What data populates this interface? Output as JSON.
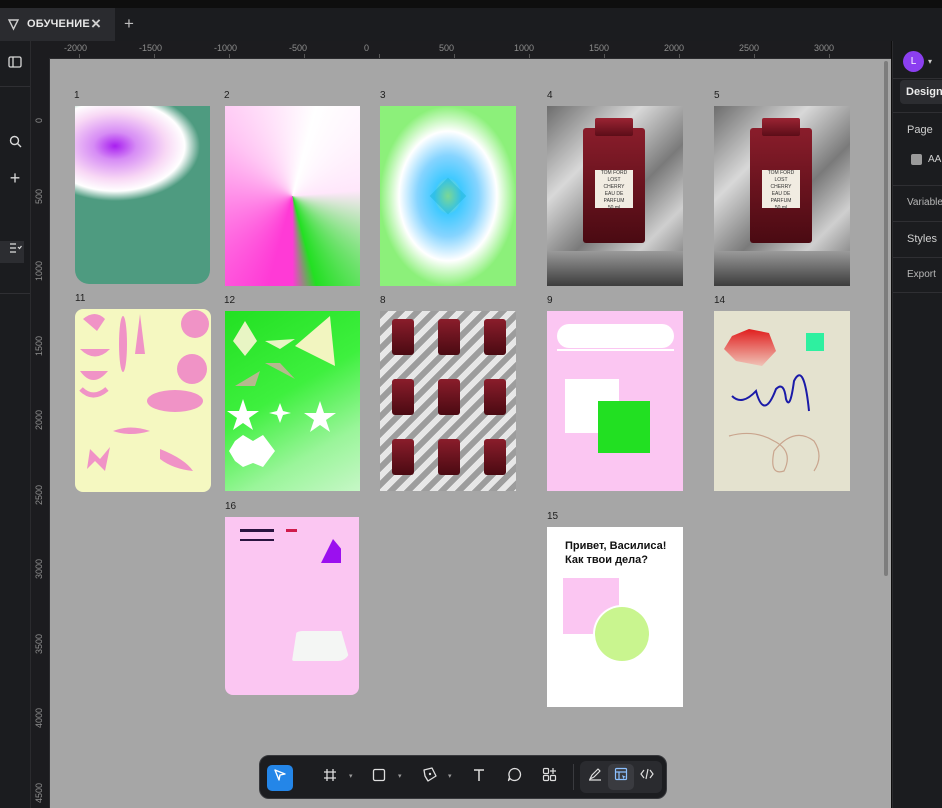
{
  "tab": {
    "title": "ОБУЧЕНИЕ",
    "close": "×",
    "new": "+"
  },
  "ruler_top": [
    "-2000",
    "-1500",
    "-1000",
    "-500",
    "0",
    "500",
    "1000",
    "1500",
    "2000",
    "2500",
    "3000"
  ],
  "ruler_left": [
    "0",
    "500",
    "1000",
    "1500",
    "2000",
    "2500",
    "3000",
    "3500",
    "4000",
    "4500"
  ],
  "frames": {
    "f1": "1",
    "f2": "2",
    "f3": "3",
    "f4": "4",
    "f5": "5",
    "f11": "11",
    "f12": "12",
    "f8": "8",
    "f9": "9",
    "f14": "14",
    "f16": "16",
    "f15": "15"
  },
  "perfume_label": {
    "brand": "TOM FORD",
    "line1": "LOST",
    "line2": "CHERRY",
    "line3": "EAU DE PARFUM",
    "line4": "50 ml"
  },
  "frame15": {
    "line1": "Привет, Василиса!",
    "line2": "Как твои дела?"
  },
  "right_panel": {
    "avatar": "L",
    "design": "Design",
    "page": "Page",
    "page_item": "AA",
    "variables": "Variable",
    "styles": "Styles",
    "export": "Export"
  },
  "colors": {
    "canvas": "#a6a6a6",
    "accent": "#2486e8",
    "pink": "#fbc6f2",
    "green": "#22e022"
  }
}
